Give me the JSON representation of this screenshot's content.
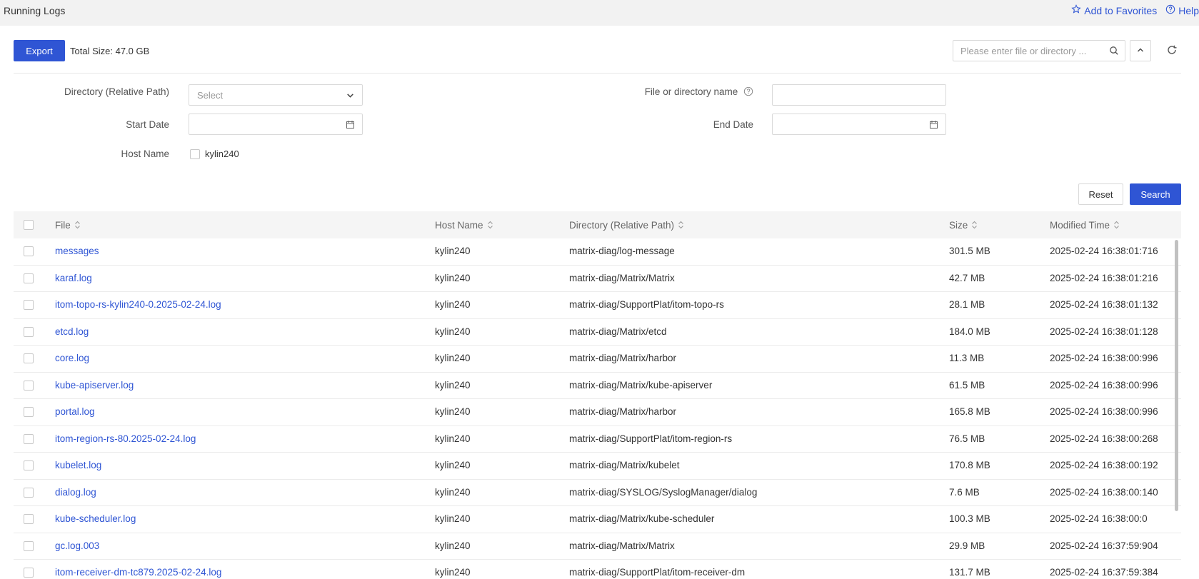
{
  "header": {
    "title": "Running Logs",
    "favorites_label": "Add to Favorites",
    "help_label": "Help"
  },
  "toolbar": {
    "export_label": "Export",
    "total_size": "Total Size: 47.0 GB",
    "search_placeholder": "Please enter file or directory ..."
  },
  "filters": {
    "directory_label": "Directory (Relative Path)",
    "directory_placeholder": "Select",
    "file_name_label": "File or directory name",
    "start_date_label": "Start Date",
    "end_date_label": "End Date",
    "host_name_label": "Host Name",
    "host_option": "kylin240",
    "reset_label": "Reset",
    "search_label": "Search"
  },
  "table": {
    "columns": [
      "File",
      "Host Name",
      "Directory (Relative Path)",
      "Size",
      "Modified Time"
    ],
    "rows": [
      {
        "file": "messages",
        "host": "kylin240",
        "dir": "matrix-diag/log-message",
        "size": "301.5 MB",
        "time": "2025-02-24 16:38:01:716"
      },
      {
        "file": "karaf.log",
        "host": "kylin240",
        "dir": "matrix-diag/Matrix/Matrix",
        "size": "42.7 MB",
        "time": "2025-02-24 16:38:01:216"
      },
      {
        "file": "itom-topo-rs-kylin240-0.2025-02-24.log",
        "host": "kylin240",
        "dir": "matrix-diag/SupportPlat/itom-topo-rs",
        "size": "28.1 MB",
        "time": "2025-02-24 16:38:01:132"
      },
      {
        "file": "etcd.log",
        "host": "kylin240",
        "dir": "matrix-diag/Matrix/etcd",
        "size": "184.0 MB",
        "time": "2025-02-24 16:38:01:128"
      },
      {
        "file": "core.log",
        "host": "kylin240",
        "dir": "matrix-diag/Matrix/harbor",
        "size": "11.3 MB",
        "time": "2025-02-24 16:38:00:996"
      },
      {
        "file": "kube-apiserver.log",
        "host": "kylin240",
        "dir": "matrix-diag/Matrix/kube-apiserver",
        "size": "61.5 MB",
        "time": "2025-02-24 16:38:00:996"
      },
      {
        "file": "portal.log",
        "host": "kylin240",
        "dir": "matrix-diag/Matrix/harbor",
        "size": "165.8 MB",
        "time": "2025-02-24 16:38:00:996"
      },
      {
        "file": "itom-region-rs-80.2025-02-24.log",
        "host": "kylin240",
        "dir": "matrix-diag/SupportPlat/itom-region-rs",
        "size": "76.5 MB",
        "time": "2025-02-24 16:38:00:268"
      },
      {
        "file": "kubelet.log",
        "host": "kylin240",
        "dir": "matrix-diag/Matrix/kubelet",
        "size": "170.8 MB",
        "time": "2025-02-24 16:38:00:192"
      },
      {
        "file": "dialog.log",
        "host": "kylin240",
        "dir": "matrix-diag/SYSLOG/SyslogManager/dialog",
        "size": "7.6 MB",
        "time": "2025-02-24 16:38:00:140"
      },
      {
        "file": "kube-scheduler.log",
        "host": "kylin240",
        "dir": "matrix-diag/Matrix/kube-scheduler",
        "size": "100.3 MB",
        "time": "2025-02-24 16:38:00:0"
      },
      {
        "file": "gc.log.003",
        "host": "kylin240",
        "dir": "matrix-diag/Matrix/Matrix",
        "size": "29.9 MB",
        "time": "2025-02-24 16:37:59:904"
      },
      {
        "file": "itom-receiver-dm-tc879.2025-02-24.log",
        "host": "kylin240",
        "dir": "matrix-diag/SupportPlat/itom-receiver-dm",
        "size": "131.7 MB",
        "time": "2025-02-24 16:37:59:384"
      }
    ]
  },
  "colors": {
    "accent": "#2f55d4",
    "header_bg": "#f2f2f2",
    "table_header_bg": "#f5f5f5"
  },
  "icons": [
    "star-icon",
    "help-circle-icon",
    "search-icon",
    "chevron-up-icon",
    "refresh-icon",
    "chevron-down-icon",
    "calendar-icon",
    "sort-icon"
  ]
}
